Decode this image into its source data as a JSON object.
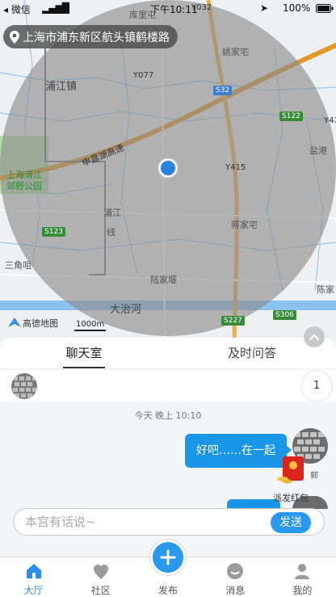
{
  "status_bar": {
    "carrier": "微信",
    "time": "下午10:11",
    "battery": "100%"
  },
  "map": {
    "address": "上海市浦东新区航头镇鹤楼路",
    "labels": {
      "kuli": "库里屯",
      "yaojia": "姚家宅",
      "pujiang": "浦江镇",
      "yanggang": "盐港",
      "park_line1": "上海浦江",
      "park_line2": "郊野公园",
      "shenjia": "申嘉湖高速",
      "puline1": "浦江",
      "puline2": "线",
      "jiangjia": "蒋家宅",
      "sanjiao": "三角咀",
      "lujia": "陆家堰",
      "dazhi": "大治河",
      "chenjia": "陈家"
    },
    "roads": {
      "y077": "Y077",
      "s32": "S32",
      "s122": "S122",
      "y41": "Y41",
      "y415": "Y415",
      "s123": "S123",
      "s227": "S227",
      "s306": "S306",
      "y032": "Y032"
    },
    "logo": "高德地图",
    "scale": "1000m"
  },
  "tabs": [
    "聊天室",
    "及时问答"
  ],
  "members": {
    "count": "1"
  },
  "chat": {
    "timestamp": "今天 晚上 10:10",
    "message": "好吧……在一起",
    "sender_short": "郭",
    "red_packet_label": "派发红包"
  },
  "input": {
    "placeholder": "本宫有话说~",
    "send": "发送"
  },
  "nav": [
    {
      "label": "大厅",
      "icon": "home-icon"
    },
    {
      "label": "社区",
      "icon": "community-icon"
    },
    {
      "label": "发布",
      "icon": "plus-icon"
    },
    {
      "label": "消息",
      "icon": "message-icon"
    },
    {
      "label": "我的",
      "icon": "profile-icon"
    }
  ],
  "colors": {
    "accent": "#2a98ee",
    "bubble": "#1a96e8",
    "highway": "#e09a2a",
    "radius_overlay": "#9a9a9a"
  }
}
